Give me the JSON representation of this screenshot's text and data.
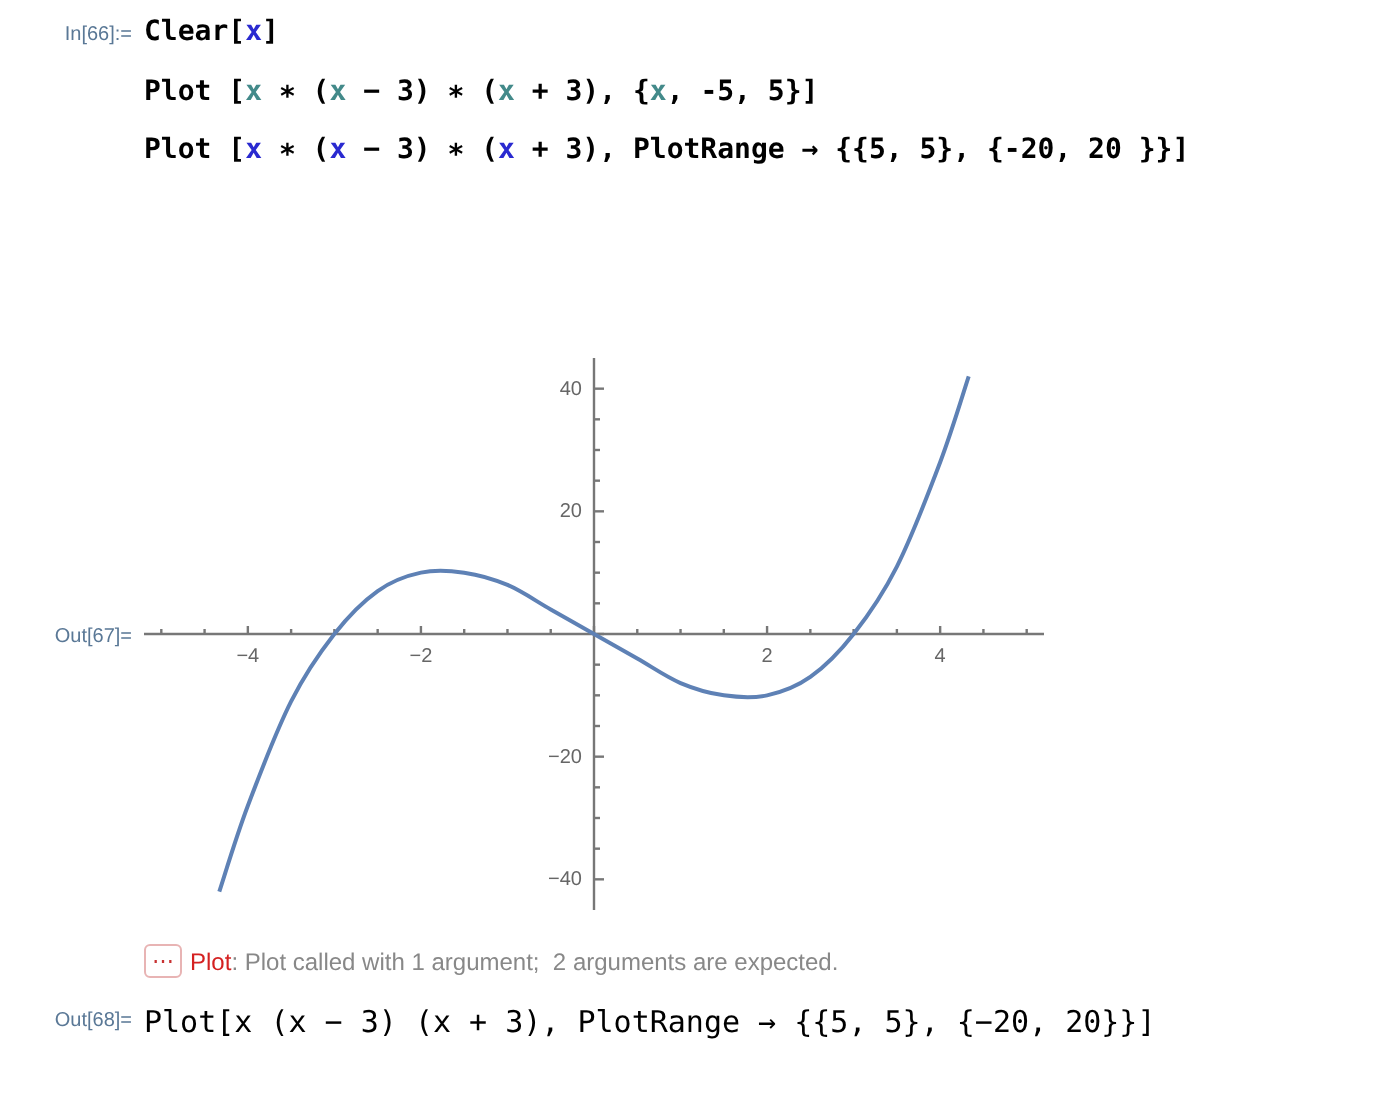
{
  "input_cell": {
    "label": "In[66]:=",
    "lines": [
      [
        {
          "text": "Clear[",
          "kind": "plain"
        },
        {
          "text": "x",
          "kind": "global"
        },
        {
          "text": "]",
          "kind": "plain"
        }
      ],
      [
        {
          "text": "Plot [",
          "kind": "plain"
        },
        {
          "text": "x",
          "kind": "local"
        },
        {
          "text": " ∗ (",
          "kind": "plain"
        },
        {
          "text": "x",
          "kind": "local"
        },
        {
          "text": " − 3) ∗ (",
          "kind": "plain"
        },
        {
          "text": "x",
          "kind": "local"
        },
        {
          "text": " + 3), {",
          "kind": "plain"
        },
        {
          "text": "x",
          "kind": "local"
        },
        {
          "text": ", -5, 5}]",
          "kind": "plain"
        }
      ],
      [
        {
          "text": "Plot [",
          "kind": "plain"
        },
        {
          "text": "x",
          "kind": "global"
        },
        {
          "text": " ∗ (",
          "kind": "plain"
        },
        {
          "text": "x",
          "kind": "global"
        },
        {
          "text": " − 3) ∗ (",
          "kind": "plain"
        },
        {
          "text": "x",
          "kind": "global"
        },
        {
          "text": " + 3), PlotRange → {{5, 5}, {-20, 20 }}]",
          "kind": "plain"
        }
      ]
    ]
  },
  "plot_output": {
    "label": "Out[67]=",
    "chart_data": {
      "type": "line",
      "x": [
        -4.33,
        -4,
        -3.5,
        -3,
        -2.5,
        -2,
        -1.5,
        -1,
        -0.5,
        0,
        0.5,
        1,
        1.5,
        2,
        2.5,
        3,
        3.5,
        4,
        4.33
      ],
      "series": [
        {
          "color": "#5e81b5",
          "values": [
            -42,
            -28,
            -11,
            0,
            7,
            10,
            10,
            8,
            4,
            0,
            -4,
            -8,
            -10,
            -10,
            -7,
            0,
            11,
            28,
            42
          ]
        }
      ],
      "xlim": [
        -5.2,
        5.2
      ],
      "ylim": [
        -45,
        45
      ],
      "xticks": [
        {
          "value": -4,
          "label": "−4"
        },
        {
          "value": -2,
          "label": "−2"
        },
        {
          "value": 2,
          "label": "2"
        },
        {
          "value": 4,
          "label": "4"
        }
      ],
      "yticks": [
        {
          "value": -40,
          "label": "−40"
        },
        {
          "value": -20,
          "label": "−20"
        },
        {
          "value": 20,
          "label": "20"
        },
        {
          "value": 40,
          "label": "40"
        }
      ]
    }
  },
  "message": {
    "button": "⋯",
    "symbol": "Plot",
    "text": ": Plot called with 1 argument;  2 arguments are expected."
  },
  "result_output": {
    "label": "Out[68]=",
    "text": "Plot[x (x − 3) (x + 3), PlotRange → {{5, 5}, {−20, 20}}]"
  }
}
